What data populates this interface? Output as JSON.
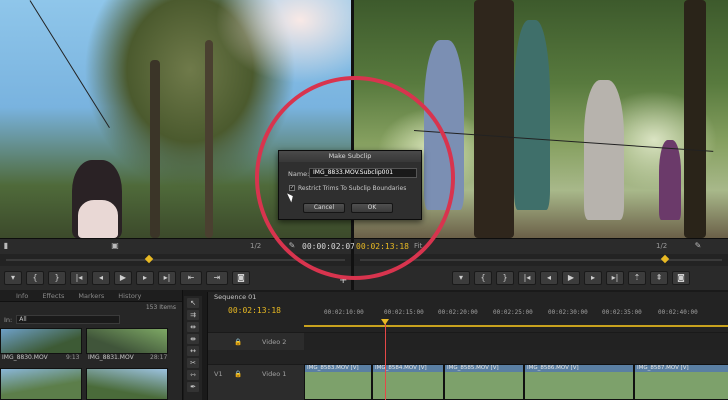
{
  "source_monitor": {
    "page_indicator": "1/2",
    "timecode": "00:00:02:07"
  },
  "program_monitor": {
    "timecode": "00:02:13:18",
    "fit": "Fit",
    "page_indicator": "1/2"
  },
  "project_panel": {
    "tabs": [
      "Info",
      "Effects",
      "Markers",
      "History"
    ],
    "item_count": "153 Items",
    "in_label": "In:",
    "in_value": "All",
    "thumbnails": [
      {
        "name": "IMG_8830.MOV",
        "duration": "9:13"
      },
      {
        "name": "IMG_8831.MOV",
        "duration": "28:17"
      }
    ]
  },
  "timeline": {
    "sequence_tab": "Sequence 01",
    "timecode": "00:02:13:18",
    "ruler": [
      "00:02:10:00",
      "00:02:15:00",
      "00:02:20:00",
      "00:02:25:00",
      "00:02:30:00",
      "00:02:35:00",
      "00:02:40:00"
    ],
    "tracks": [
      {
        "id": "V2",
        "name": "Video 2"
      },
      {
        "id": "V1",
        "name": "Video 1"
      }
    ],
    "clips": [
      "IMG_8583.MOV [V]",
      "IMG_8584.MOV [V]",
      "IMG_8585.MOV [V]",
      "IMG_8586.MOV [V]",
      "IMG_8587.MOV [V]"
    ]
  },
  "dialog": {
    "title": "Make Subclip",
    "name_label": "Name:",
    "name_value": "IMG_8833.MOV.Subclip001",
    "checkbox_checked": true,
    "checkbox_label": "Restrict Trims To Subclip Boundaries",
    "cancel_label": "Cancel",
    "ok_label": "OK"
  },
  "highlight_color": "#d8344e",
  "timecode_color": "#e8b923"
}
